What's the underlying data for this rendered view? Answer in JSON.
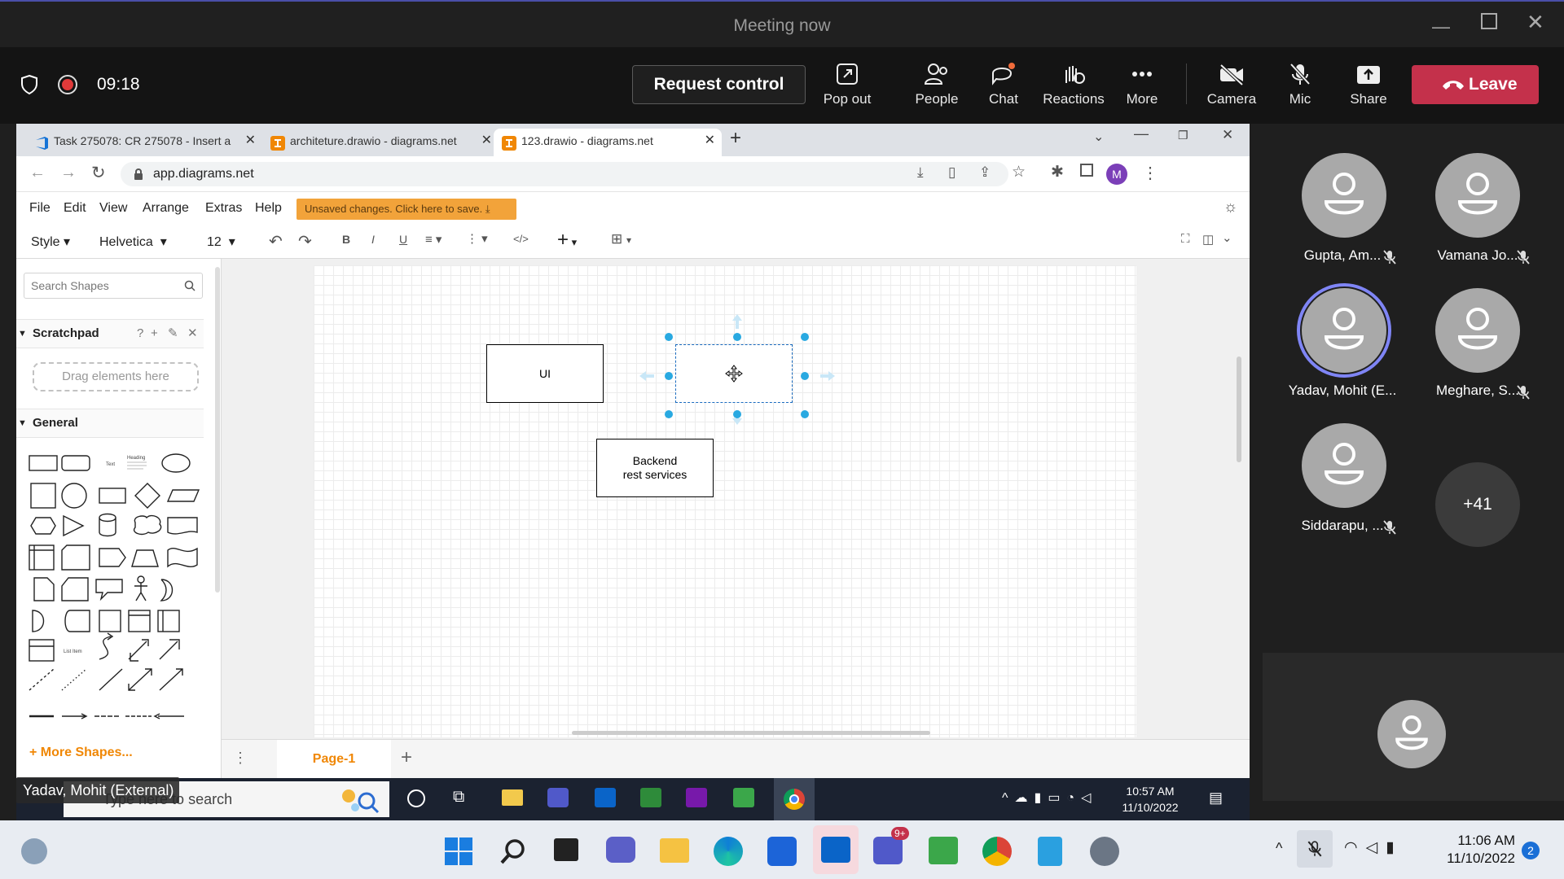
{
  "window": {
    "title": "Meeting now"
  },
  "meeting": {
    "timer": "09:18",
    "request_control_label": "Request control",
    "buttons": [
      {
        "label": "Pop out",
        "icon": "pop-out-icon"
      },
      {
        "label": "People",
        "icon": "people-icon"
      },
      {
        "label": "Chat",
        "icon": "chat-icon"
      },
      {
        "label": "Reactions",
        "icon": "reactions-icon"
      },
      {
        "label": "More",
        "icon": "more-icon"
      },
      {
        "label": "Camera",
        "icon": "camera-off-icon"
      },
      {
        "label": "Mic",
        "icon": "mic-off-icon"
      },
      {
        "label": "Share",
        "icon": "share-icon"
      }
    ],
    "leave_label": "Leave",
    "presenter_tag": "Yadav, Mohit (External)"
  },
  "browser": {
    "tabs": [
      {
        "title": "Task 275078: CR 275078 - Insert a"
      },
      {
        "title": "architeture.drawio - diagrams.net"
      },
      {
        "title": "123.drawio - diagrams.net"
      }
    ],
    "url": "app.diagrams.net",
    "profile_initial": "M"
  },
  "drawio": {
    "menus": [
      "File",
      "Edit",
      "View",
      "Arrange",
      "Extras",
      "Help"
    ],
    "unsaved_banner": "Unsaved changes. Click here to save.",
    "toolbar": {
      "style": "Style",
      "font": "Helvetica",
      "size": "12"
    },
    "search_placeholder": "Search Shapes",
    "scratchpad_title": "Scratchpad",
    "drag_hint": "Drag elements here",
    "general_title": "General",
    "more_shapes": "More Shapes...",
    "page_tab": "Page-1",
    "nodes": {
      "ui": "UI",
      "backend_line1": "Backend",
      "backend_line2": "rest services"
    }
  },
  "remote_taskbar": {
    "search_placeholder": "Type here to search",
    "time": "10:57 AM",
    "date": "11/10/2022"
  },
  "participants": [
    {
      "name": "Gupta, Am...",
      "muted": true
    },
    {
      "name": "Vamana Jo...",
      "muted": true
    },
    {
      "name": "Yadav, Mohit (E...",
      "muted": false,
      "speaking": true
    },
    {
      "name": "Meghare, S...",
      "muted": true
    },
    {
      "name": "Siddarapu, ...",
      "muted": true
    }
  ],
  "overflow_count": "+41",
  "local_taskbar": {
    "time": "11:06 AM",
    "date": "11/10/2022",
    "notifications": "2",
    "teams_badge": "9+"
  },
  "colors": {
    "leave": "#c4314b",
    "accent_orange": "#f08705",
    "selection": "#29a9e1",
    "unsaved": "#f2a33a"
  }
}
